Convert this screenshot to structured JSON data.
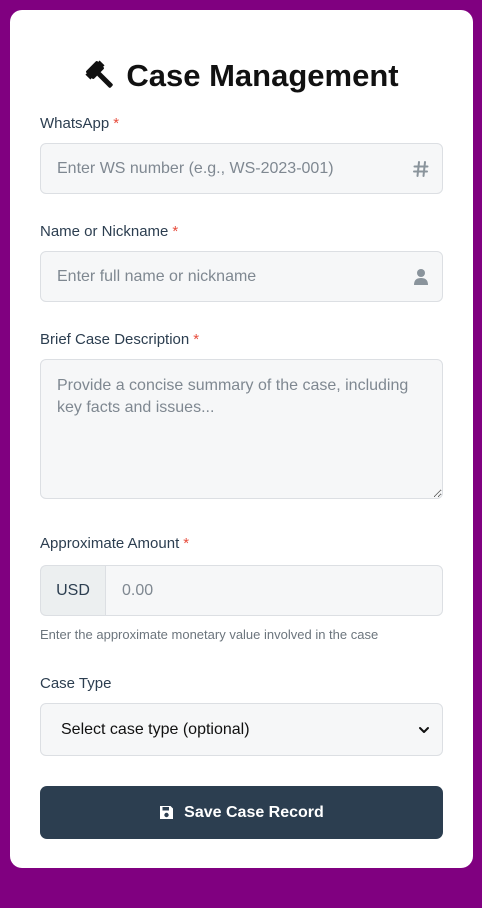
{
  "form": {
    "title": "Case Management",
    "title_icon": "gavel-icon",
    "required_marker": "*",
    "whatsapp": {
      "label": "WhatsApp",
      "placeholder": "Enter WS number (e.g., WS-2023-001)",
      "icon": "hash-icon"
    },
    "name": {
      "label": "Name or Nickname",
      "placeholder": "Enter full name or nickname",
      "icon": "user-icon"
    },
    "description": {
      "label": "Brief Case Description",
      "placeholder": "Provide a concise summary of the case, including key facts and issues..."
    },
    "amount": {
      "label": "Approximate Amount",
      "currency": "USD",
      "placeholder": "0.00",
      "hint": "Enter the approximate monetary value involved in the case"
    },
    "case_type": {
      "label": "Case Type",
      "selected": "Select case type (optional)"
    },
    "save_button": {
      "label": "Save Case Record",
      "icon": "floppy-disk-icon"
    }
  },
  "colors": {
    "background": "#800080",
    "button": "#2c3e50",
    "required": "#e74c3c"
  }
}
